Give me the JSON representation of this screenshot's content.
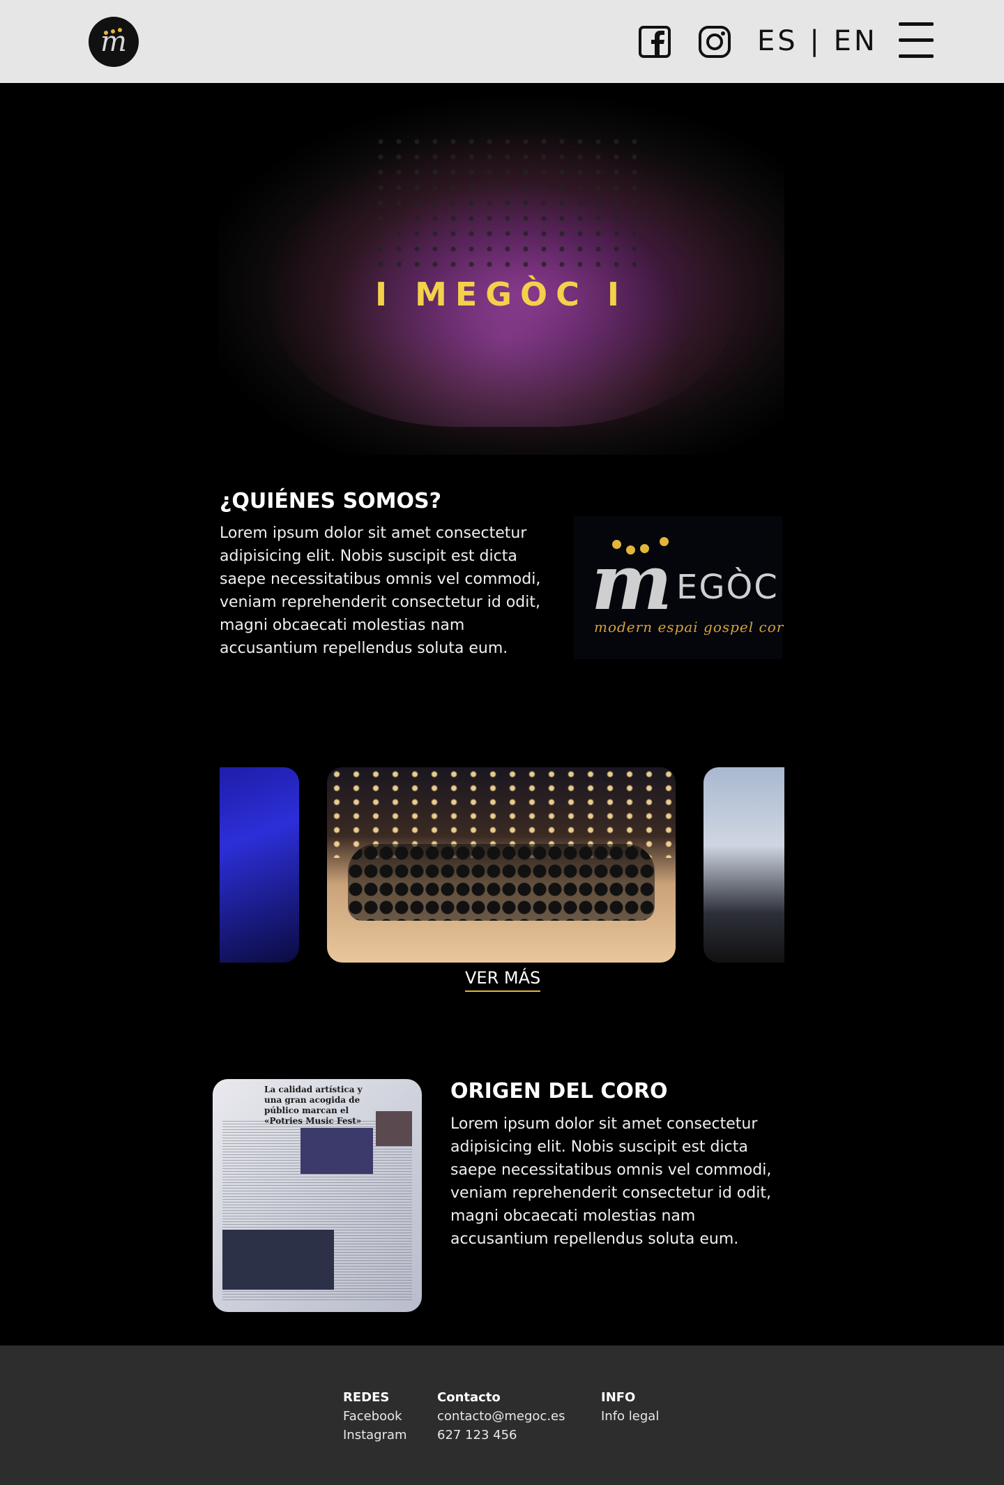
{
  "header": {
    "lang_label": "ES | EN",
    "icons": [
      "facebook-icon",
      "instagram-icon",
      "menu-icon"
    ],
    "logo_letter": "m"
  },
  "hero": {
    "title": "I MEGÒC I"
  },
  "about": {
    "title": "¿QUIÉNES SOMOS?",
    "text": "Lorem ipsum dolor sit amet consectetur adipisicing elit. Nobis suscipit est dicta saepe necessitatibus omnis vel commodi, veniam reprehenderit consectetur id odit, magni obcaecati molestias nam accusantium repellendus soluta eum.",
    "logo_text": "EGÒC",
    "logo_big_letter": "m",
    "logo_tagline": "modern espai gospel cor"
  },
  "gallery": {
    "more_label": "VER MÁS"
  },
  "origin": {
    "title": "ORIGEN DEL CORO",
    "text": "Lorem ipsum dolor sit amet consectetur adipisicing elit. Nobis suscipit est dicta saepe necessitatibus omnis vel commodi, veniam reprehenderit consectetur id odit, magni obcaecati molestias nam accusantium repellendus soluta eum.",
    "news_headline": "La calidad artística y una gran acogida de público marcan el «Potries Music Fest»"
  },
  "footer": {
    "redes": {
      "heading": "REDES",
      "items": [
        "Facebook",
        "Instagram"
      ]
    },
    "contacto": {
      "heading": "Contacto",
      "items": [
        "contacto@megoc.es",
        "627 123 456"
      ]
    },
    "info": {
      "heading": "INFO",
      "items": [
        "Info legal"
      ]
    }
  },
  "colors": {
    "accent": "#e3b63a",
    "header_bg": "#e6e6e6",
    "footer_bg": "#2d2d2d",
    "page_bg": "#000000"
  }
}
